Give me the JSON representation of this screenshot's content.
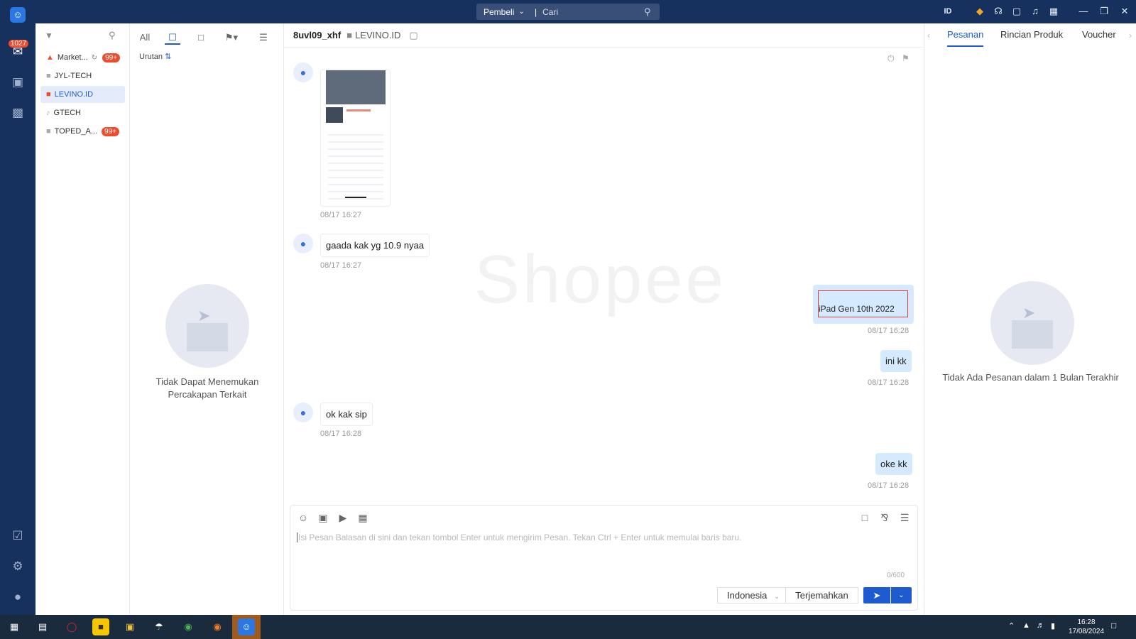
{
  "topbar": {
    "search_scope": "Pembeli",
    "search_placeholder": "Cari",
    "lang": "ID"
  },
  "rail": {
    "unread_count": "1027"
  },
  "stores": [
    {
      "name": "Market...",
      "badge": "99+"
    },
    {
      "name": "JYL-TECH",
      "badge": ""
    },
    {
      "name": "LEVINO.ID",
      "badge": ""
    },
    {
      "name": "GTECH",
      "badge": ""
    },
    {
      "name": "TOPED_A...",
      "badge": "99+"
    }
  ],
  "convo": {
    "tab_all": "All",
    "sort_label": "Urutan",
    "empty_line1": "Tidak Dapat Menemukan",
    "empty_line2": "Percakapan Terkait"
  },
  "chat": {
    "username": "8uvl09_xhf",
    "shop": "LEVINO.ID",
    "watermark": "Shopee",
    "messages": [
      {
        "dir": "in",
        "type": "image",
        "time": "08/17 16:27"
      },
      {
        "dir": "in",
        "text": "gaada kak yg 10.9 nyaa",
        "time": "08/17 16:27"
      },
      {
        "dir": "out",
        "text": "iPad Gen 10th 2022",
        "time": "08/17 16:28"
      },
      {
        "dir": "out",
        "text": "ini kk",
        "time": "08/17 16:28"
      },
      {
        "dir": "in",
        "text": "ok kak sip",
        "time": "08/17 16:28"
      },
      {
        "dir": "out",
        "text": "oke kk",
        "time": "08/17 16:28"
      }
    ],
    "composer_placeholder": "Isi Pesan Balasan di sini dan tekan tombol Enter untuk mengirim Pesan. Tekan Ctrl + Enter untuk memulai baris baru.",
    "char_count": "0/600",
    "language": "Indonesia",
    "translate": "Terjemahkan"
  },
  "right": {
    "tabs": [
      "Pesanan",
      "Rincian Produk",
      "Voucher"
    ],
    "empty": "Tidak Ada Pesanan dalam 1 Bulan Terakhir"
  },
  "taskbar": {
    "time": "16:28",
    "date": "17/08/2024"
  },
  "colors": {
    "brand_navy": "#17315e",
    "accent_blue": "#1f5bd0",
    "badge_red": "#ee4d2d",
    "out_bubble": "#d6eaff"
  }
}
